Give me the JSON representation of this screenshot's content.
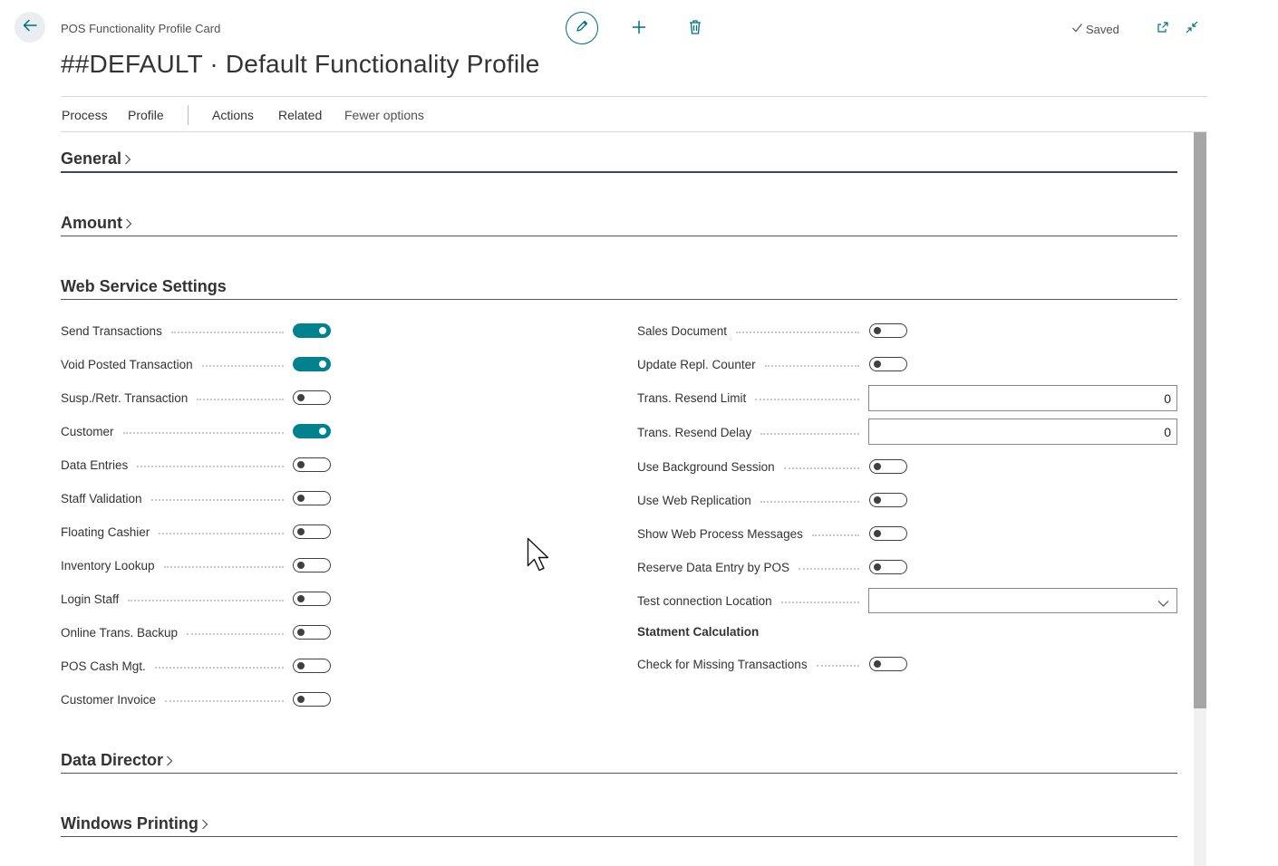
{
  "header": {
    "caption": "POS Functionality Profile Card",
    "title": "##DEFAULT · Default Functionality Profile",
    "saved_status": "Saved"
  },
  "action_bar": {
    "items": [
      "Process",
      "Profile",
      "Actions",
      "Related"
    ],
    "fewer_options": "Fewer options"
  },
  "sections": {
    "general": "General",
    "amount": "Amount",
    "web_service": "Web Service Settings",
    "data_director": "Data Director",
    "windows_printing": "Windows Printing"
  },
  "left_fields": [
    {
      "label": "Send Transactions",
      "on": true
    },
    {
      "label": "Void Posted Transaction",
      "on": true
    },
    {
      "label": "Susp./Retr. Transaction",
      "on": false
    },
    {
      "label": "Customer",
      "on": true
    },
    {
      "label": "Data Entries",
      "on": false
    },
    {
      "label": "Staff Validation",
      "on": false
    },
    {
      "label": "Floating Cashier",
      "on": false
    },
    {
      "label": "Inventory Lookup",
      "on": false
    },
    {
      "label": "Login Staff",
      "on": false
    },
    {
      "label": "Online Trans. Backup",
      "on": false
    },
    {
      "label": "POS Cash Mgt.",
      "on": false
    },
    {
      "label": "Customer Invoice",
      "on": false
    }
  ],
  "right_fields": {
    "sales_document": {
      "label": "Sales Document",
      "on": false
    },
    "update_repl_counter": {
      "label": "Update Repl. Counter",
      "on": false
    },
    "trans_resend_limit": {
      "label": "Trans. Resend Limit",
      "value": "0"
    },
    "trans_resend_delay": {
      "label": "Trans. Resend Delay",
      "value": "0"
    },
    "use_background_session": {
      "label": "Use Background Session",
      "on": false
    },
    "use_web_replication": {
      "label": "Use Web Replication",
      "on": false
    },
    "show_web_process_messages": {
      "label": "Show Web Process Messages",
      "on": false
    },
    "reserve_data_entry": {
      "label": "Reserve Data Entry by POS",
      "on": false
    },
    "test_connection_location": {
      "label": "Test connection Location",
      "value": ""
    },
    "statement_group": "Statment Calculation",
    "check_missing_transactions": {
      "label": "Check for Missing Transactions",
      "on": false
    }
  },
  "colors": {
    "accent": "#00838f",
    "toggle_off": "#404040"
  }
}
